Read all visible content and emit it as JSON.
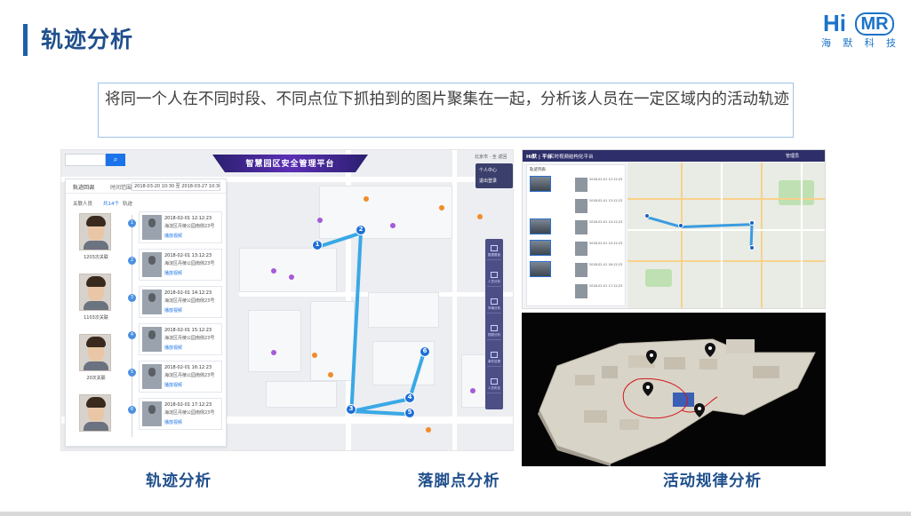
{
  "slide": {
    "title": "轨迹分析",
    "description": "将同一个人在不同时段、不同点位下抓拍到的图片聚集在一起，分析该人员在一定区域内的活动轨迹",
    "accent_color": "#1f4f8c"
  },
  "logo": {
    "hi": "Hi",
    "mr": "MR",
    "cn": [
      "海",
      "默",
      "科",
      "技"
    ]
  },
  "captions": {
    "left": "轨迹分析",
    "middle": "落脚点分析",
    "right": "活动规律分析"
  },
  "left_screenshot": {
    "platform_title": "智慧园区安全管理平台",
    "search_placeholder": "",
    "search_icon": "search-icon",
    "top_right": "北京市 · 全 返回",
    "user_menu": [
      "个人中心",
      "退出登录"
    ],
    "panel": {
      "tab_track": "轨迹回调",
      "tab_time": "时间范围",
      "time_range": "2018-03-20 10:30 至 2018-03-27 10:30",
      "sub_related": "关联人员",
      "sub_count": "共14个",
      "sub_track": "轨迹",
      "persons": [
        {
          "label": "1203次关联"
        },
        {
          "label": "1103次关联"
        },
        {
          "label": "20次关联"
        }
      ],
      "records": [
        {
          "time": "2018-02-01 12:12:23",
          "place": "海淀区丹棱公园南侧23号",
          "play": "播放视频"
        },
        {
          "time": "2018-02-01 13:12:23",
          "place": "海淀区丹棱公园南侧23号",
          "play": "播放视频"
        },
        {
          "time": "2018-02-01 14:12:23",
          "place": "海淀区丹棱公园南侧23号",
          "play": "播放视频"
        },
        {
          "time": "2018-02-01 15:12:23",
          "place": "海淀区丹棱公园南侧23号",
          "play": "播放视频"
        },
        {
          "time": "2018-02-01 16:12:23",
          "place": "海淀区丹棱公园南侧23号",
          "play": "播放视频"
        },
        {
          "time": "2018-02-01 17:12:23",
          "place": "海淀区丹棱公园南侧23号",
          "play": "播放视频"
        }
      ]
    },
    "toolbar": [
      "数据看板",
      "人员分析",
      "车辆分析",
      "视频分析",
      "事件处理",
      "人员布控"
    ],
    "track_points": [
      "1",
      "2",
      "3",
      "4",
      "5",
      "6"
    ]
  },
  "right_top_screenshot": {
    "header_logo": "Hi默 | 平台",
    "header_title": "实时视频结构化平台",
    "header_user": "管理员",
    "list_head": "轨迹列表",
    "rows": [
      "2018-02-01 12:12:23",
      "2018-02-01 13:12:23",
      "2018-02-01 14:12:23",
      "2018-02-01 15:12:23",
      "2018-02-01 16:12:23",
      "2018-02-01 17:12:23"
    ]
  }
}
